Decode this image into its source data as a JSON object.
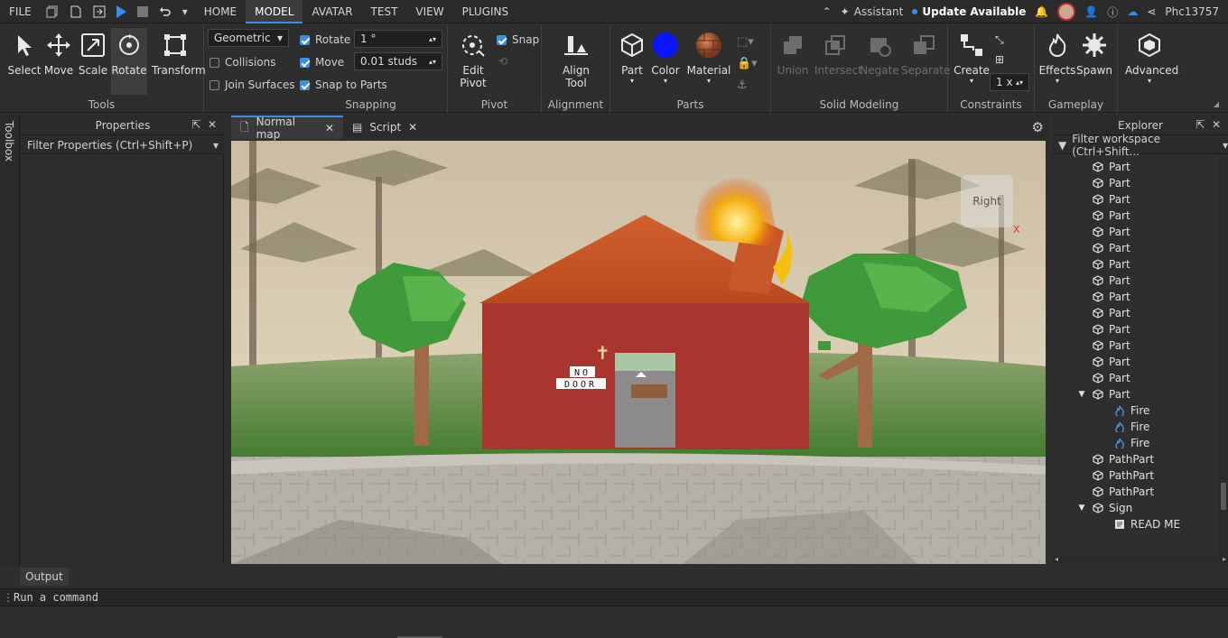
{
  "menu": {
    "file": "FILE",
    "tabs": [
      "HOME",
      "MODEL",
      "AVATAR",
      "TEST",
      "VIEW",
      "PLUGINS"
    ],
    "assistant": "Assistant",
    "update": "Update Available",
    "user": "Phc13757"
  },
  "ribbon": {
    "tools": {
      "select": "Select",
      "move": "Move",
      "scale": "Scale",
      "rotate": "Rotate",
      "transform": "Transform",
      "title": "Tools"
    },
    "mode": "Geometric",
    "collisions": "Collisions",
    "join_surfaces": "Join Surfaces",
    "snapping": {
      "rotate": "Rotate",
      "rotate_value": "1 °",
      "move": "Move",
      "move_value": "0.01 studs",
      "snap_to_parts": "Snap to Parts",
      "title": "Snapping"
    },
    "pivot": {
      "edit": "Edit",
      "pivot": "Pivot",
      "snap": "Snap",
      "title": "Pivot"
    },
    "alignment": {
      "align": "Align",
      "tool": "Tool",
      "title": "Alignment"
    },
    "parts": {
      "part": "Part",
      "color": "Color",
      "material": "Material",
      "title": "Parts",
      "color_value": "#0a14ff"
    },
    "solid_modeling": {
      "union": "Union",
      "intersect": "Intersect",
      "negate": "Negate",
      "separate": "Separate",
      "title": "Solid Modeling"
    },
    "constraints": {
      "create": "Create",
      "scale": "1 x",
      "title": "Constraints"
    },
    "gameplay": {
      "effects": "Effects",
      "spawn": "Spawn",
      "title": "Gameplay"
    },
    "advanced": "Advanced"
  },
  "toolbox_tab": "Toolbox",
  "properties": {
    "title": "Properties",
    "filter": "Filter Properties (Ctrl+Shift+P)"
  },
  "editor_tabs": [
    {
      "label": "Normal map",
      "active": true
    },
    {
      "label": "Script",
      "active": false
    }
  ],
  "viewport": {
    "cube_label": "Right",
    "sign_line1": "NO",
    "sign_line2": "DOOR"
  },
  "explorer": {
    "title": "Explorer",
    "filter": "Filter workspace (Ctrl+Shift...",
    "items": [
      {
        "label": "Part",
        "type": "part",
        "indent": 0
      },
      {
        "label": "Part",
        "type": "part",
        "indent": 0
      },
      {
        "label": "Part",
        "type": "part",
        "indent": 0
      },
      {
        "label": "Part",
        "type": "part",
        "indent": 0
      },
      {
        "label": "Part",
        "type": "part",
        "indent": 0
      },
      {
        "label": "Part",
        "type": "part",
        "indent": 0
      },
      {
        "label": "Part",
        "type": "part",
        "indent": 0
      },
      {
        "label": "Part",
        "type": "part",
        "indent": 0
      },
      {
        "label": "Part",
        "type": "part",
        "indent": 0
      },
      {
        "label": "Part",
        "type": "part",
        "indent": 0
      },
      {
        "label": "Part",
        "type": "part",
        "indent": 0
      },
      {
        "label": "Part",
        "type": "part",
        "indent": 0
      },
      {
        "label": "Part",
        "type": "part",
        "indent": 0
      },
      {
        "label": "Part",
        "type": "part",
        "indent": 0
      },
      {
        "label": "Part",
        "type": "part",
        "indent": 0,
        "expanded": true
      },
      {
        "label": "Fire",
        "type": "fire",
        "indent": 1
      },
      {
        "label": "Fire",
        "type": "fire",
        "indent": 1
      },
      {
        "label": "Fire",
        "type": "fire",
        "indent": 1
      },
      {
        "label": "PathPart",
        "type": "part",
        "indent": 0
      },
      {
        "label": "PathPart",
        "type": "part",
        "indent": 0
      },
      {
        "label": "PathPart",
        "type": "part",
        "indent": 0
      },
      {
        "label": "Sign",
        "type": "part",
        "indent": 0,
        "expanded": true
      },
      {
        "label": "READ ME",
        "type": "script",
        "indent": 1
      }
    ]
  },
  "output": {
    "title": "Output",
    "command_placeholder": "Run a command"
  }
}
